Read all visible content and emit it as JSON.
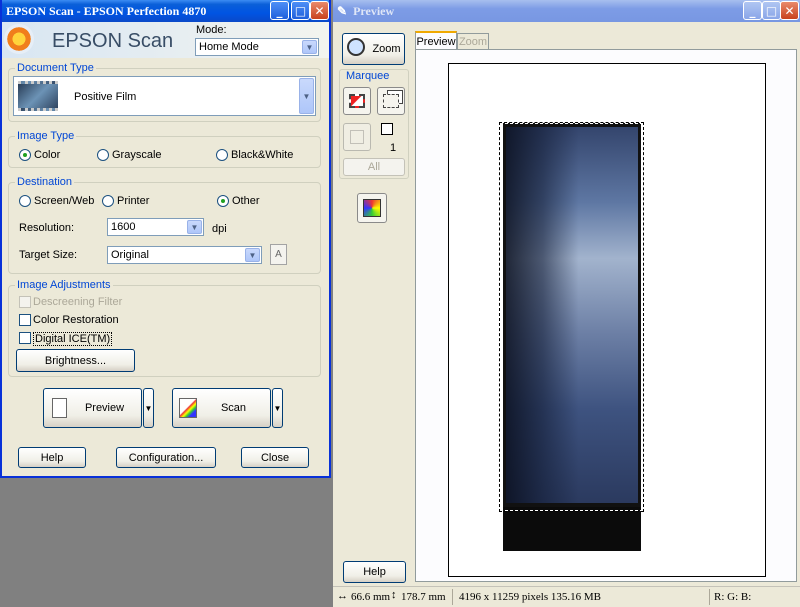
{
  "main": {
    "title": "EPSON Scan - EPSON Perfection 4870",
    "brand": "EPSON Scan",
    "mode_label": "Mode:",
    "mode_value": "Home Mode",
    "document_type": {
      "title": "Document Type",
      "value": "Positive Film"
    },
    "image_type": {
      "title": "Image Type",
      "options": [
        "Color",
        "Grayscale",
        "Black&White"
      ],
      "selected": "Color"
    },
    "destination": {
      "title": "Destination",
      "options": [
        "Screen/Web",
        "Printer",
        "Other"
      ],
      "selected": "Other",
      "resolution_label": "Resolution:",
      "resolution_value": "1600",
      "resolution_unit": "dpi",
      "target_label": "Target Size:",
      "target_value": "Original"
    },
    "adjustments": {
      "title": "Image Adjustments",
      "descreening": "Descreening Filter",
      "color_restoration": "Color Restoration",
      "digital_ice": "Digital ICE(TM)",
      "brightness_button": "Brightness..."
    },
    "preview_button": "Preview",
    "scan_button": "Scan",
    "help_button": "Help",
    "config_button": "Configuration...",
    "close_button": "Close"
  },
  "preview": {
    "title": "Preview",
    "zoom_button": "Zoom",
    "marquee_label": "Marquee",
    "marquee_count": "1",
    "all_button": "All",
    "tabs": [
      "Preview",
      "Zoom"
    ],
    "help_button": "Help",
    "status": {
      "width": "66.6 mm",
      "height": "178.7 mm",
      "pixels": "4196 x 11259 pixels 135.16 MB",
      "rgb": "R: G: B:"
    }
  }
}
